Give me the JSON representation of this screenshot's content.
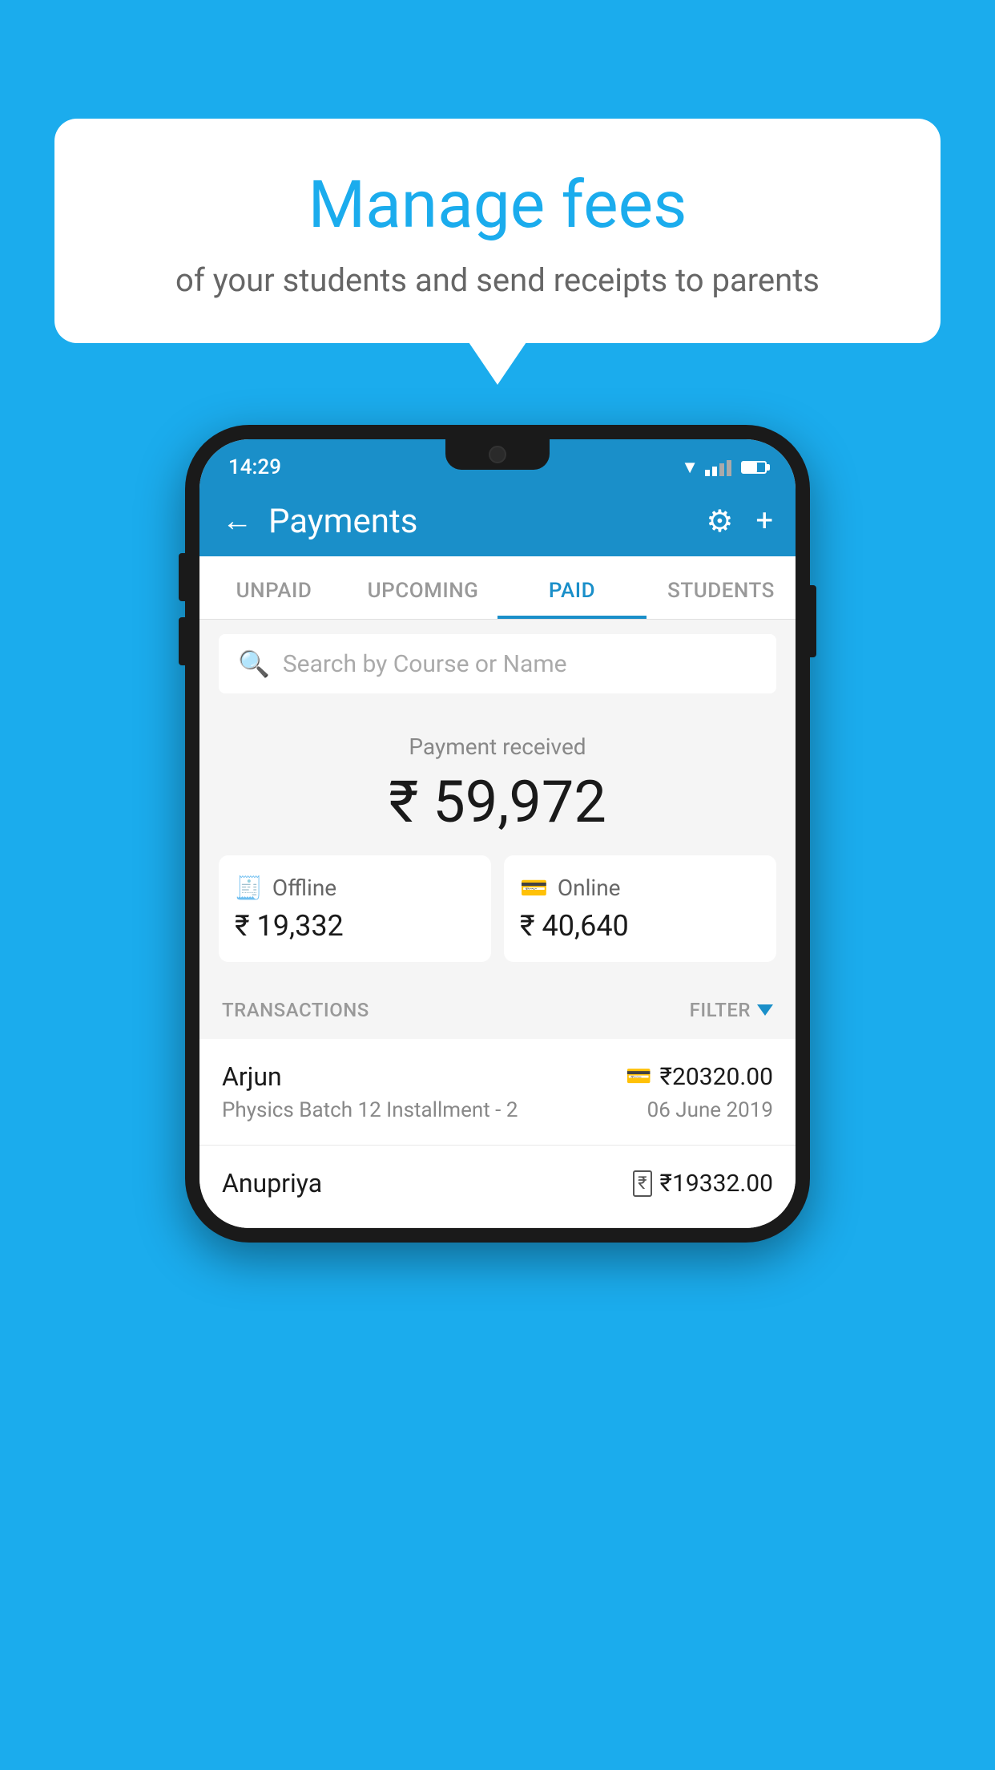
{
  "background_color": "#1BACED",
  "bubble": {
    "title": "Manage fees",
    "subtitle": "of your students and send receipts to parents"
  },
  "status_bar": {
    "time": "14:29"
  },
  "app_bar": {
    "title": "Payments",
    "back_label": "←",
    "settings_label": "⚙",
    "add_label": "+"
  },
  "tabs": [
    {
      "label": "UNPAID",
      "active": false
    },
    {
      "label": "UPCOMING",
      "active": false
    },
    {
      "label": "PAID",
      "active": true
    },
    {
      "label": "STUDENTS",
      "active": false
    }
  ],
  "search": {
    "placeholder": "Search by Course or Name"
  },
  "payment_summary": {
    "label": "Payment received",
    "amount": "₹ 59,972",
    "offline_label": "Offline",
    "offline_amount": "₹ 19,332",
    "online_label": "Online",
    "online_amount": "₹ 40,640"
  },
  "transactions": {
    "header_label": "TRANSACTIONS",
    "filter_label": "FILTER",
    "rows": [
      {
        "name": "Arjun",
        "detail": "Physics Batch 12 Installment - 2",
        "amount": "₹20320.00",
        "date": "06 June 2019",
        "payment_type": "card"
      },
      {
        "name": "Anupriya",
        "detail": "",
        "amount": "₹19332.00",
        "date": "",
        "payment_type": "rupee"
      }
    ]
  }
}
